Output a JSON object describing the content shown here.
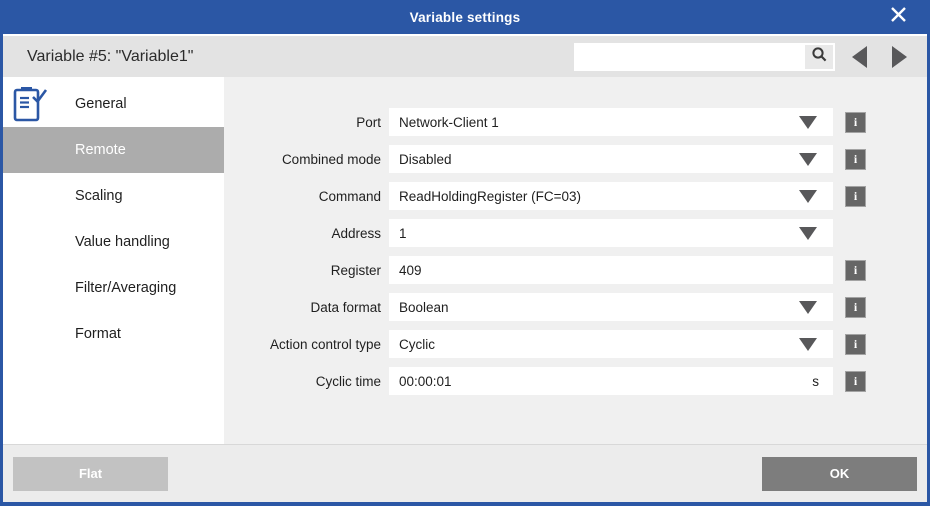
{
  "titlebar": {
    "title": "Variable settings"
  },
  "header": {
    "subtitle": "Variable #5: \"Variable1\"",
    "search": {
      "value": "",
      "placeholder": ""
    }
  },
  "sidebar": {
    "items": [
      {
        "label": "General",
        "selected": false
      },
      {
        "label": "Remote",
        "selected": true
      },
      {
        "label": "Scaling",
        "selected": false
      },
      {
        "label": "Value handling",
        "selected": false
      },
      {
        "label": "Filter/Averaging",
        "selected": false
      },
      {
        "label": "Format",
        "selected": false
      }
    ]
  },
  "form": {
    "rows": [
      {
        "label": "Port",
        "value": "Network-Client 1",
        "type": "dropdown",
        "unit": "",
        "info": true
      },
      {
        "label": "Combined mode",
        "value": "Disabled",
        "type": "dropdown",
        "unit": "",
        "info": true
      },
      {
        "label": "Command",
        "value": "ReadHoldingRegister (FC=03)",
        "type": "dropdown",
        "unit": "",
        "info": true
      },
      {
        "label": "Address",
        "value": "1",
        "type": "dropdown",
        "unit": "",
        "info": false
      },
      {
        "label": "Register",
        "value": "409",
        "type": "text",
        "unit": "",
        "info": true
      },
      {
        "label": "Data format",
        "value": "Boolean",
        "type": "dropdown",
        "unit": "",
        "info": true
      },
      {
        "label": "Action control type",
        "value": "Cyclic",
        "type": "dropdown",
        "unit": "",
        "info": true
      },
      {
        "label": "Cyclic time",
        "value": "00:00:01",
        "type": "text",
        "unit": "s",
        "info": true
      }
    ],
    "info_glyph": "i"
  },
  "footer": {
    "flat_label": "Flat",
    "ok_label": "OK"
  },
  "icons": {
    "titlebar_close": "close-x",
    "header_leading": "clipboard-checklist",
    "search": "magnifier",
    "nav_prev": "left-triangle",
    "nav_next": "right-triangle",
    "dropdown": "down-triangle",
    "info": "letter-i"
  },
  "colors": {
    "accent": "#2b57a5",
    "titlebar_text": "#ffffff",
    "header_bg": "#e3e3e3",
    "content_bg": "#f0f0f0",
    "sidebar_bg": "#ffffff",
    "selected_bg": "#acacac",
    "selected_text": "#ffffff",
    "field_bg": "#ffffff",
    "text": "#1f1f1f",
    "arrow": "#58585a",
    "info_bg": "#666666",
    "info_border": "#a3a3a3",
    "flat_bg": "#c2c2c2",
    "ok_bg": "#7d7d7d",
    "button_text": "#ffffff",
    "footer_bg": "#ececec"
  }
}
